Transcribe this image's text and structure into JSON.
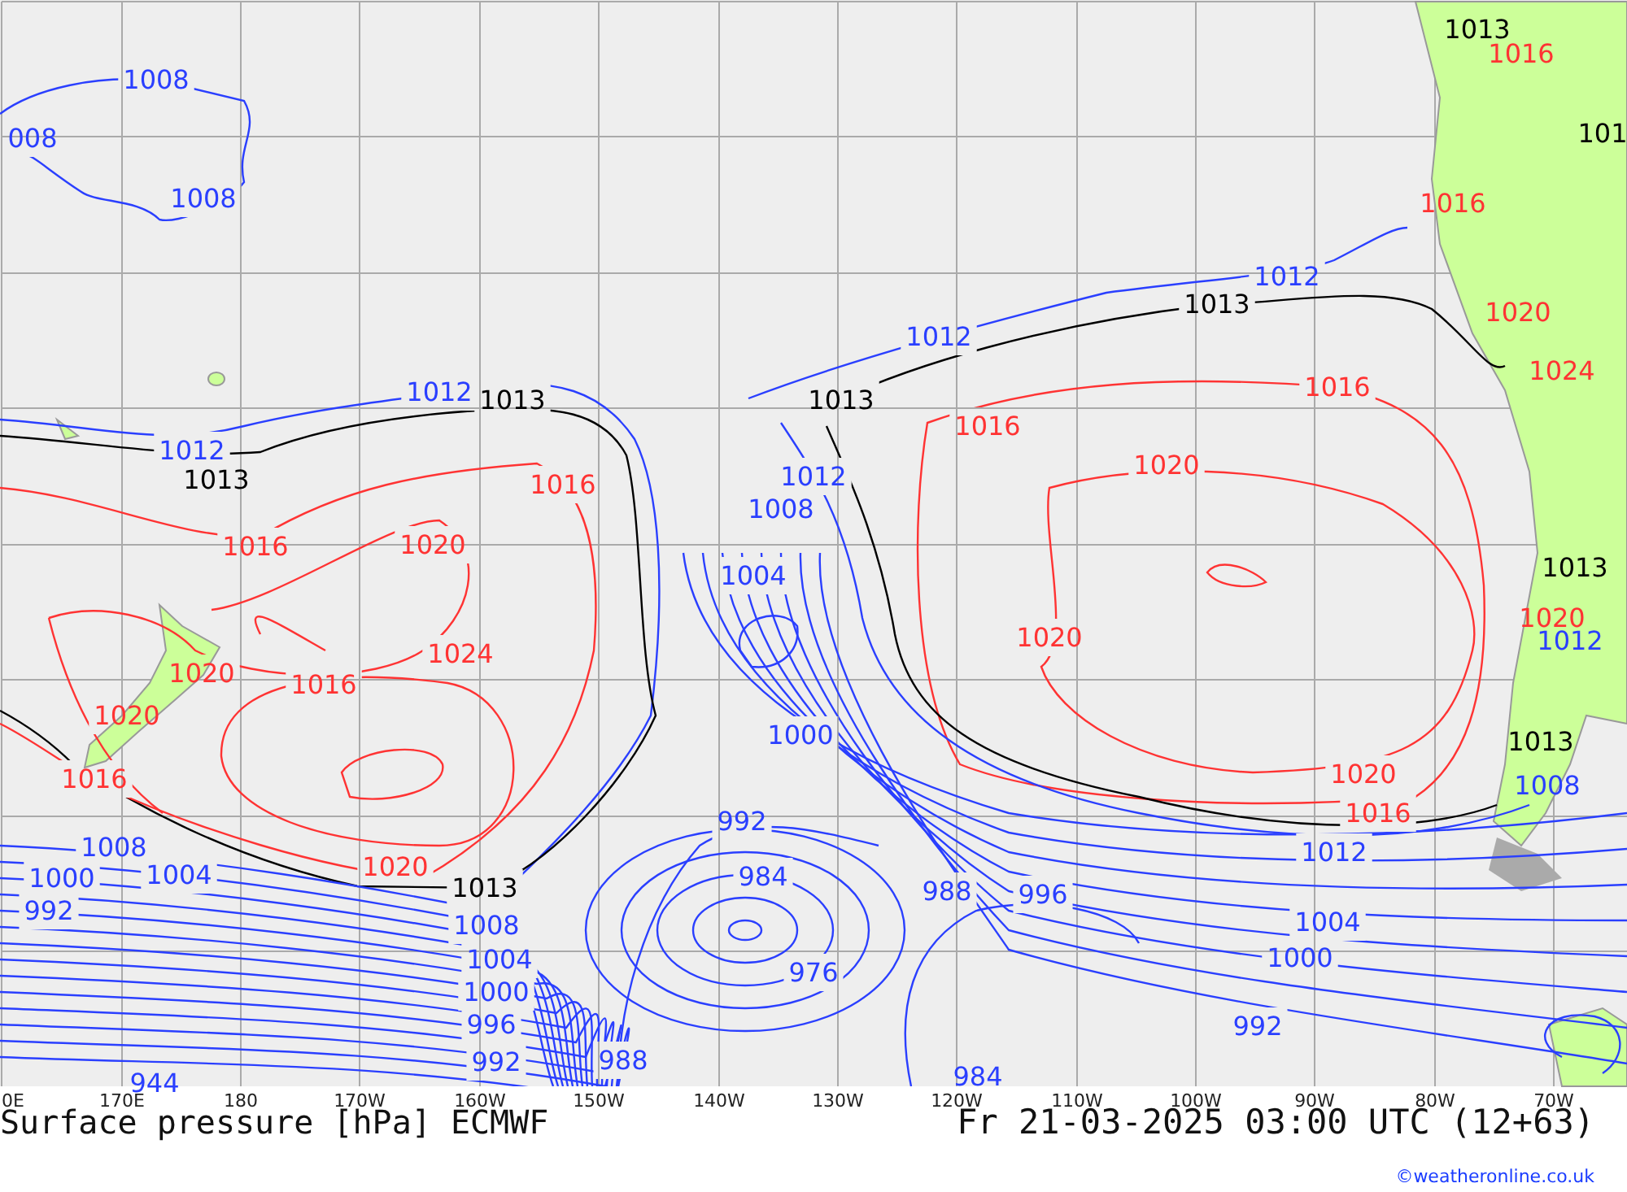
{
  "map": {
    "isobar_labels": [
      {
        "text": "1008",
        "kind": "low"
      },
      {
        "text": "008",
        "kind": "low"
      },
      {
        "text": "1008",
        "kind": "low"
      },
      {
        "text": "1012",
        "kind": "low"
      },
      {
        "text": "1013",
        "kind": "mid"
      },
      {
        "text": "1012",
        "kind": "low"
      },
      {
        "text": "1013",
        "kind": "mid"
      },
      {
        "text": "1016",
        "kind": "high"
      },
      {
        "text": "1016",
        "kind": "high"
      },
      {
        "text": "1020",
        "kind": "high"
      },
      {
        "text": "1024",
        "kind": "high"
      },
      {
        "text": "1016",
        "kind": "high"
      },
      {
        "text": "1020",
        "kind": "high"
      },
      {
        "text": "1020",
        "kind": "high"
      },
      {
        "text": "1016",
        "kind": "high"
      },
      {
        "text": "1020",
        "kind": "high"
      },
      {
        "text": "1013",
        "kind": "mid"
      },
      {
        "text": "1008",
        "kind": "low"
      },
      {
        "text": "1000",
        "kind": "low"
      },
      {
        "text": "1004",
        "kind": "low"
      },
      {
        "text": "992",
        "kind": "low"
      },
      {
        "text": "1008",
        "kind": "low"
      },
      {
        "text": "1004",
        "kind": "low"
      },
      {
        "text": "1000",
        "kind": "low"
      },
      {
        "text": "996",
        "kind": "low"
      },
      {
        "text": "992",
        "kind": "low"
      },
      {
        "text": "944",
        "kind": "low"
      },
      {
        "text": "988",
        "kind": "low"
      },
      {
        "text": "1004",
        "kind": "low"
      },
      {
        "text": "1008",
        "kind": "low"
      },
      {
        "text": "1012",
        "kind": "low"
      },
      {
        "text": "1013",
        "kind": "mid"
      },
      {
        "text": "1012",
        "kind": "low"
      },
      {
        "text": "1016",
        "kind": "high"
      },
      {
        "text": "1013",
        "kind": "mid"
      },
      {
        "text": "1012",
        "kind": "low"
      },
      {
        "text": "1016",
        "kind": "high"
      },
      {
        "text": "1020",
        "kind": "high"
      },
      {
        "text": "1020",
        "kind": "high"
      },
      {
        "text": "1000",
        "kind": "low"
      },
      {
        "text": "992",
        "kind": "low"
      },
      {
        "text": "984",
        "kind": "low"
      },
      {
        "text": "976",
        "kind": "low"
      },
      {
        "text": "988",
        "kind": "low"
      },
      {
        "text": "996",
        "kind": "low"
      },
      {
        "text": "984",
        "kind": "low"
      },
      {
        "text": "1020",
        "kind": "high"
      },
      {
        "text": "1016",
        "kind": "high"
      },
      {
        "text": "1012",
        "kind": "low"
      },
      {
        "text": "1004",
        "kind": "low"
      },
      {
        "text": "1000",
        "kind": "low"
      },
      {
        "text": "992",
        "kind": "low"
      },
      {
        "text": "1013",
        "kind": "mid"
      },
      {
        "text": "1016",
        "kind": "high"
      },
      {
        "text": "1016",
        "kind": "high"
      },
      {
        "text": "101",
        "kind": "mid"
      },
      {
        "text": "1020",
        "kind": "high"
      },
      {
        "text": "1024",
        "kind": "high"
      },
      {
        "text": "1013",
        "kind": "mid"
      },
      {
        "text": "1020",
        "kind": "high"
      },
      {
        "text": "1012",
        "kind": "low"
      },
      {
        "text": "1013",
        "kind": "mid"
      },
      {
        "text": "1008",
        "kind": "low"
      }
    ],
    "longitude_labels": [
      "0E",
      "170E",
      "180",
      "170W",
      "160W",
      "150W",
      "140W",
      "130W",
      "120W",
      "110W",
      "100W",
      "90W",
      "80W",
      "70W"
    ]
  },
  "title": "Surface pressure [hPa] ECMWF",
  "valid_time": "Fr 21-03-2025 03:00 UTC (12+63)",
  "credit": "©weatheronline.co.uk"
}
